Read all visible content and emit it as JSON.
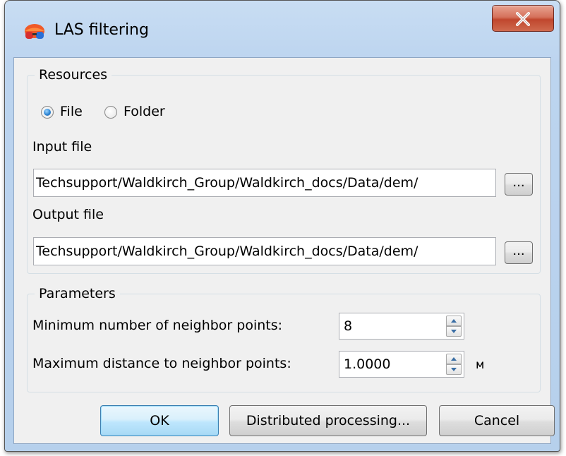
{
  "window": {
    "title": "LAS filtering",
    "close_glyph": "X",
    "icon": "3d-glasses-icon",
    "accent_colors": {
      "close_button": "#c8553d",
      "default_button": "#bee6fd",
      "frame": "#b9d1ea"
    }
  },
  "resources": {
    "group_title": "Resources",
    "mode_options": [
      {
        "label": "File",
        "checked": true
      },
      {
        "label": "Folder",
        "checked": false
      }
    ],
    "input_label": "Input file",
    "input_value": "Techsupport/Waldkirch_Group/Waldkirch_docs/Data/dem/",
    "output_label": "Output file",
    "output_value": "Techsupport/Waldkirch_Group/Waldkirch_docs/Data/dem/",
    "browse_label": "..."
  },
  "parameters": {
    "group_title": "Parameters",
    "min_neighbors_label": "Minimum number of neighbor points:",
    "min_neighbors_value": "8",
    "max_distance_label": "Maximum distance to neighbor points:",
    "max_distance_value": "1.0000",
    "max_distance_unit": "м"
  },
  "buttons": {
    "ok": "OK",
    "distributed": "Distributed processing...",
    "cancel": "Cancel"
  }
}
